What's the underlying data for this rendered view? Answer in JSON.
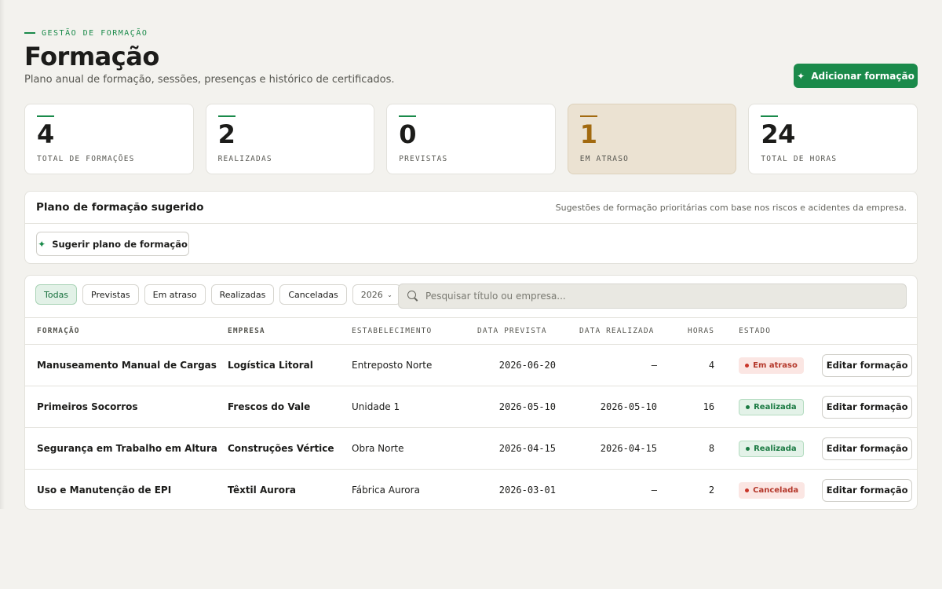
{
  "header": {
    "eyebrow": "GESTÃO DE FORMAÇÃO",
    "title": "Formação",
    "subtitle": "Plano anual de formação, sessões, presenças e histórico de certificados.",
    "add_button": "Adicionar formação"
  },
  "stats": [
    {
      "value": "4",
      "label": "TOTAL DE FORMAÇÕES"
    },
    {
      "value": "2",
      "label": "REALIZADAS"
    },
    {
      "value": "0",
      "label": "PREVISTAS"
    },
    {
      "value": "1",
      "label": "EM ATRASO"
    },
    {
      "value": "24",
      "label": "TOTAL DE HORAS"
    }
  ],
  "plan": {
    "title": "Plano de formação sugerido",
    "description": "Sugestões de formação prioritárias com base nos riscos e acidentes da empresa.",
    "button": "Sugerir plano de formação"
  },
  "filters": {
    "chips": [
      "Todas",
      "Previstas",
      "Em atraso",
      "Realizadas",
      "Canceladas"
    ],
    "active": "Todas",
    "year": "2026",
    "search_placeholder": "Pesquisar título ou empresa..."
  },
  "table": {
    "columns": [
      "FORMAÇÃO",
      "EMPRESA",
      "ESTABELECIMENTO",
      "DATA PREVISTA",
      "DATA REALIZADA",
      "HORAS",
      "ESTADO"
    ],
    "edit_label": "Editar formação",
    "rows": [
      {
        "title": "Manuseamento Manual de Cargas",
        "company": "Logística Litoral",
        "estab": "Entreposto Norte",
        "planned": "2026-06-20",
        "done": "—",
        "hours": "4",
        "status": "Em atraso"
      },
      {
        "title": "Primeiros Socorros",
        "company": "Frescos do Vale",
        "estab": "Unidade 1",
        "planned": "2026-05-10",
        "done": "2026-05-10",
        "hours": "16",
        "status": "Realizada"
      },
      {
        "title": "Segurança em Trabalho em Altura",
        "company": "Construções Vértice",
        "estab": "Obra Norte",
        "planned": "2026-04-15",
        "done": "2026-04-15",
        "hours": "8",
        "status": "Realizada"
      },
      {
        "title": "Uso e Manutenção de EPI",
        "company": "Têxtil Aurora",
        "estab": "Fábrica Aurora",
        "planned": "2026-03-01",
        "done": "—",
        "hours": "2",
        "status": "Cancelada"
      }
    ]
  },
  "icons": {
    "add": "sparkle-icon",
    "search": "search-icon",
    "chevron": "chevron-down-icon"
  },
  "colors": {
    "accent": "#1a8a4a",
    "late": "#a26a10",
    "danger": "#b4372a"
  }
}
